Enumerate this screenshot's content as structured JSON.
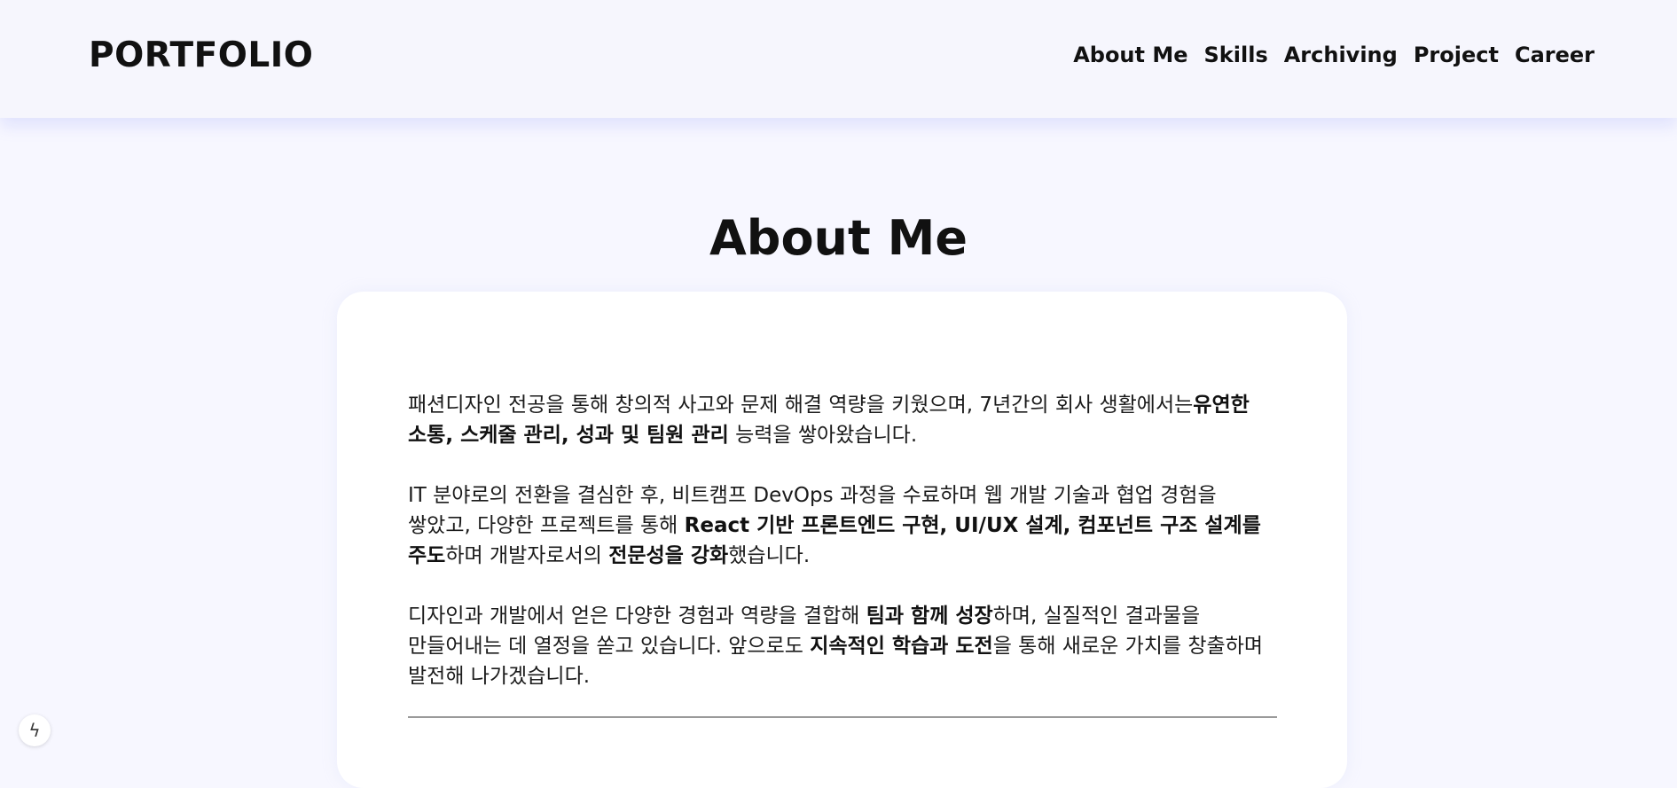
{
  "header": {
    "logo": "PORTFOLIO",
    "nav": [
      "About Me",
      "Skills",
      "Archiving",
      "Project",
      "Career"
    ]
  },
  "section": {
    "title": "About Me",
    "paragraphs": [
      [
        {
          "text": "패션디자인 전공을 통해 창의적 사고와 문제 해결 역량을 키웠으며, 7년간의 회사 생활에서는",
          "bold": false
        },
        {
          "text": "유연한 소통, 스케줄 관리, 성과 및 팀원 관리",
          "bold": true
        },
        {
          "text": " 능력을 쌓아왔습니다.",
          "bold": false
        }
      ],
      [
        {
          "text": "IT 분야로의 전환을 결심한 후, 비트캠프 DevOps 과정을 수료하며 웹 개발 기술과 협업 경험을 쌓았고, 다양한 프로젝트를 통해 ",
          "bold": false
        },
        {
          "text": "React 기반 프론트엔드 구현, UI/UX 설계, 컴포넌트 구조 설계를 주도",
          "bold": true
        },
        {
          "text": "하며 개발자로서의 ",
          "bold": false
        },
        {
          "text": "전문성을 강화",
          "bold": true
        },
        {
          "text": "했습니다.",
          "bold": false
        }
      ],
      [
        {
          "text": "디자인과 개발에서 얻은 다양한 경험과 역량을 결합해 ",
          "bold": false
        },
        {
          "text": "팀과 함께 성장",
          "bold": true
        },
        {
          "text": "하며, 실질적인 결과물을 만들어내는 데 열정을 쏟고 있습니다. 앞으로도 ",
          "bold": false
        },
        {
          "text": "지속적인 학습과 도전",
          "bold": true
        },
        {
          "text": "을 통해 새로운 가치를 창출하며 발전해 나가겠습니다.",
          "bold": false
        }
      ]
    ]
  },
  "widget": {
    "icon": "lightning-icon",
    "glyph": "ϟ"
  }
}
